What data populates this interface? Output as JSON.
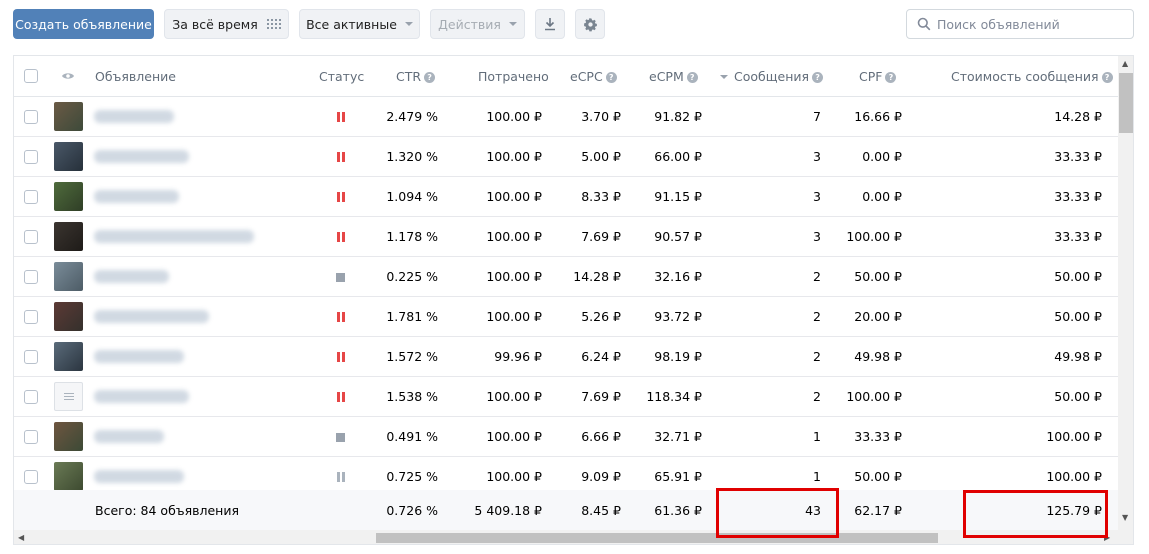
{
  "toolbar": {
    "create_label": "Создать объявление",
    "period_label": "За всё время",
    "filter_label": "Все активные",
    "actions_label": "Действия",
    "search_placeholder": "Поиск объявлений"
  },
  "table": {
    "columns": {
      "ad": "Объявление",
      "status": "Статус",
      "ctr": "CTR",
      "spent": "Потрачено",
      "ecpc": "eCPC",
      "ecpm": "eCPM",
      "messages": "Сообщения",
      "cpf": "CPF",
      "msg_cost": "Стоимость сообщения"
    },
    "sort_column": "messages",
    "rows": [
      {
        "thumb": "photo",
        "status": "paused",
        "ctr": "2.479 %",
        "spent": "100.00 ₽",
        "ecpc": "3.70 ₽",
        "ecpm": "91.82 ₽",
        "messages": "7",
        "cpf": "16.66 ₽",
        "msg_cost": "14.28 ₽"
      },
      {
        "thumb": "photo",
        "status": "paused",
        "ctr": "1.320 %",
        "spent": "100.00 ₽",
        "ecpc": "5.00 ₽",
        "ecpm": "66.00 ₽",
        "messages": "3",
        "cpf": "0.00 ₽",
        "msg_cost": "33.33 ₽"
      },
      {
        "thumb": "photo",
        "status": "paused",
        "ctr": "1.094 %",
        "spent": "100.00 ₽",
        "ecpc": "8.33 ₽",
        "ecpm": "91.15 ₽",
        "messages": "3",
        "cpf": "0.00 ₽",
        "msg_cost": "33.33 ₽"
      },
      {
        "thumb": "photo",
        "status": "paused",
        "ctr": "1.178 %",
        "spent": "100.00 ₽",
        "ecpc": "7.69 ₽",
        "ecpm": "90.57 ₽",
        "messages": "3",
        "cpf": "100.00 ₽",
        "msg_cost": "33.33 ₽"
      },
      {
        "thumb": "photo",
        "status": "stopped",
        "ctr": "0.225 %",
        "spent": "100.00 ₽",
        "ecpc": "14.28 ₽",
        "ecpm": "32.16 ₽",
        "messages": "2",
        "cpf": "50.00 ₽",
        "msg_cost": "50.00 ₽"
      },
      {
        "thumb": "photo",
        "status": "paused",
        "ctr": "1.781 %",
        "spent": "100.00 ₽",
        "ecpc": "5.26 ₽",
        "ecpm": "93.72 ₽",
        "messages": "2",
        "cpf": "20.00 ₽",
        "msg_cost": "50.00 ₽"
      },
      {
        "thumb": "photo",
        "status": "paused",
        "ctr": "1.572 %",
        "spent": "99.96 ₽",
        "ecpc": "6.24 ₽",
        "ecpm": "98.19 ₽",
        "messages": "2",
        "cpf": "49.98 ₽",
        "msg_cost": "49.98 ₽"
      },
      {
        "thumb": "document",
        "status": "paused",
        "ctr": "1.538 %",
        "spent": "100.00 ₽",
        "ecpc": "7.69 ₽",
        "ecpm": "118.34 ₽",
        "messages": "2",
        "cpf": "100.00 ₽",
        "msg_cost": "50.00 ₽"
      },
      {
        "thumb": "photo",
        "status": "stopped",
        "ctr": "0.491 %",
        "spent": "100.00 ₽",
        "ecpc": "6.66 ₽",
        "ecpm": "32.71 ₽",
        "messages": "1",
        "cpf": "33.33 ₽",
        "msg_cost": "100.00 ₽"
      },
      {
        "thumb": "photo",
        "status": "paused-gray",
        "ctr": "0.725 %",
        "spent": "100.00 ₽",
        "ecpc": "9.09 ₽",
        "ecpm": "65.91 ₽",
        "messages": "1",
        "cpf": "50.00 ₽",
        "msg_cost": "100.00 ₽"
      }
    ],
    "total": {
      "label": "Всего: 84 объявления",
      "ctr": "0.726 %",
      "spent": "5 409.18 ₽",
      "ecpc": "8.45 ₽",
      "ecpm": "61.36 ₽",
      "messages": "43",
      "cpf": "62.17 ₽",
      "msg_cost": "125.79 ₽"
    }
  },
  "colors": {
    "primary": "#5181b8",
    "paused": "#e64646",
    "highlight": "#e00000"
  }
}
